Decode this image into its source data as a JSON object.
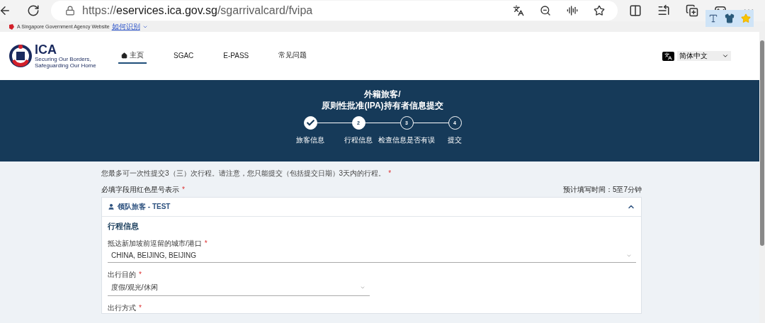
{
  "browser": {
    "url_host": "eservices.ica.gov.sg",
    "url_scheme": "https://",
    "url_path": "/sgarrivalcard/fvipa"
  },
  "gov_bar": {
    "text": "A Singapore Government Agency Website",
    "link": "如何识别"
  },
  "header": {
    "logo": {
      "text": "ICA",
      "tagline": "Securing Our Borders, Safeguarding Our Home"
    },
    "nav": [
      {
        "label": "主页",
        "selected": true,
        "kind": "home"
      },
      {
        "label": "SGAC",
        "selected": false,
        "kind": "plain"
      },
      {
        "label": "E-PASS",
        "selected": false,
        "kind": "plain"
      },
      {
        "label": "常见问题",
        "selected": false,
        "kind": "plain"
      }
    ],
    "language": "简体中文"
  },
  "banner": {
    "title_lines": [
      "外籍旅客/",
      "原则性批准(IPA)持有者信息提交"
    ],
    "steps": [
      {
        "label": "旅客信息",
        "kind": "done"
      },
      {
        "label": "行程信息",
        "number": "2",
        "kind": "current"
      },
      {
        "label": "检查信息是否有误",
        "number": "3",
        "kind": "pending"
      },
      {
        "label": "提交",
        "number": "4",
        "kind": "pending"
      }
    ]
  },
  "notice": {
    "text": "您最多可一次性提交3（三）次行程。请注意，您只能提交（包括提交日期）3天内的行程。",
    "required": true
  },
  "asterisk": "*",
  "required_hint": "必填字段用红色星号表示",
  "time_hint": "预计填写时间：5至7分钟",
  "panel": {
    "title": "领队旅客 - TEST",
    "expanded": true,
    "section": "行程信息",
    "fields": [
      {
        "label": "抵达新加坡前逗留的城市/港口",
        "required": true,
        "value": "CHINA, BEIJING, BEIJING",
        "wide": true
      },
      {
        "label": "出行目的",
        "required": true,
        "value": "度假/观光/休闲",
        "wide": false
      },
      {
        "label": "出行方式",
        "required": true
      }
    ]
  }
}
